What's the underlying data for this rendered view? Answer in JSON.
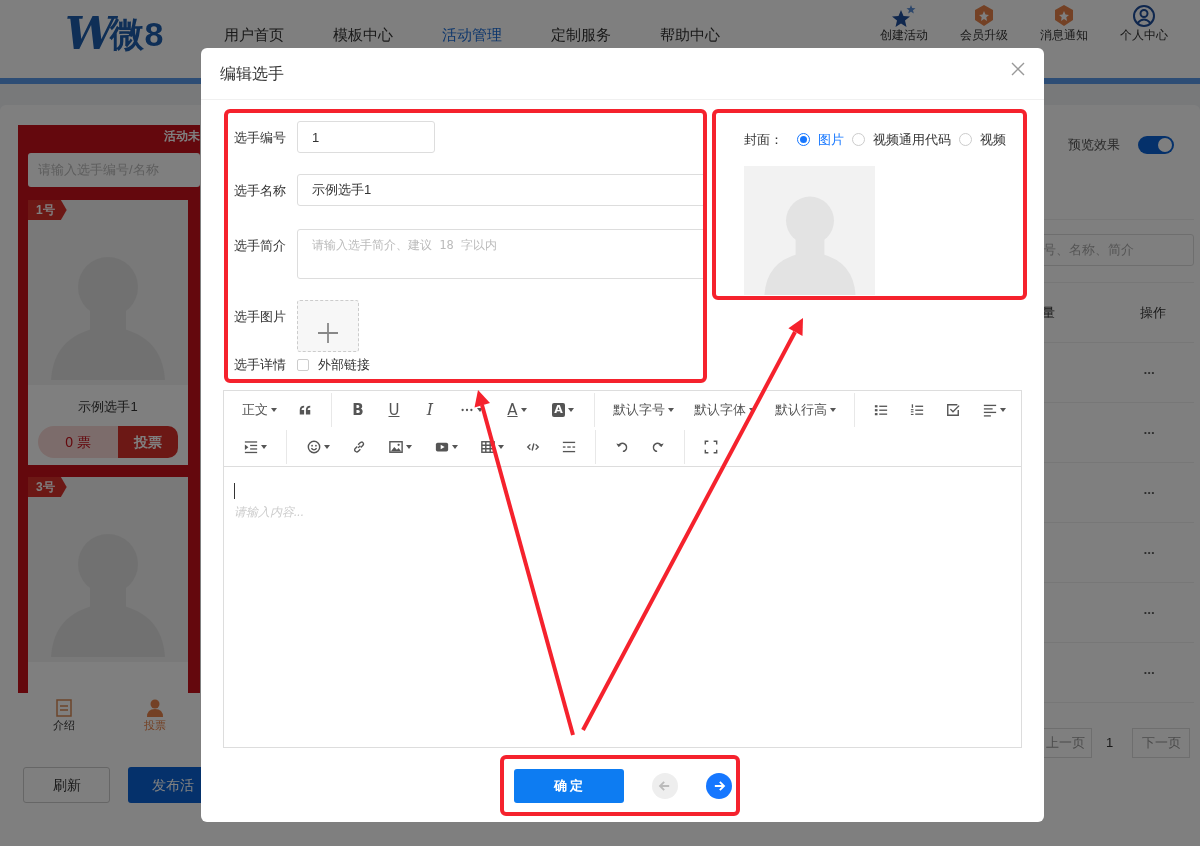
{
  "header": {
    "logo": {
      "mark": "W",
      "text": "微8"
    },
    "nav": [
      {
        "label": "用户首页",
        "selected": false
      },
      {
        "label": "模板中心",
        "selected": false
      },
      {
        "label": "活动管理",
        "selected": true
      },
      {
        "label": "定制服务",
        "selected": false
      },
      {
        "label": "帮助中心",
        "selected": false
      }
    ],
    "actions": [
      {
        "label": "创建活动"
      },
      {
        "label": "会员升级"
      },
      {
        "label": "消息通知"
      },
      {
        "label": "个人中心"
      }
    ]
  },
  "preview": {
    "status": "活动未",
    "search": {
      "placeholder": "请输入选手编号/名称"
    },
    "cards": [
      {
        "badge": "1号",
        "name": "示例选手1",
        "votes": "0 票",
        "vote_button": "投票"
      },
      {
        "badge": "3号"
      }
    ],
    "tabs": [
      {
        "label": "介绍",
        "selected": false
      },
      {
        "label": "投票",
        "selected": true
      }
    ]
  },
  "buttons": [
    {
      "label": "刷新",
      "kind": "default"
    },
    {
      "label": "发布活",
      "kind": "primary"
    }
  ],
  "right_panel": {
    "preview_toggle": {
      "label": "预览效果",
      "on": true
    },
    "search": {
      "placeholder": "号、名称、简介"
    },
    "columns": [
      "量",
      "操作"
    ],
    "rows": [
      {
        "action": "•••"
      },
      {
        "action": "•••"
      },
      {
        "action": "•••"
      },
      {
        "action": "•••"
      },
      {
        "action": "•••"
      },
      {
        "action": "•••"
      }
    ],
    "pagination": {
      "prev": "上一页",
      "page": "1",
      "next": "下一页"
    }
  },
  "dialog": {
    "title": "编辑选手",
    "form": [
      {
        "label": "选手编号",
        "kind": "input",
        "value": "1"
      },
      {
        "label": "选手名称",
        "kind": "input",
        "value": "示例选手1"
      },
      {
        "label": "选手简介",
        "kind": "textarea",
        "placeholder": "请输入选手简介、建议 18 字以内"
      },
      {
        "label": "选手图片",
        "kind": "upload"
      },
      {
        "label": "选手详情",
        "kind": "checkbox",
        "text": "外部链接",
        "checked": false
      }
    ],
    "cover": {
      "label": "封面：",
      "options": [
        {
          "label": "图片",
          "selected": true
        },
        {
          "label": "视频通用代码",
          "selected": false
        },
        {
          "label": "视频",
          "selected": false
        }
      ]
    },
    "editor": {
      "toolbar": [
        [
          [
            {
              "kind": "label",
              "text": "正文",
              "dropdown": true
            },
            {
              "kind": "icon",
              "dropdown": false
            }
          ],
          [
            {
              "kind": "bold",
              "text": "B",
              "dropdown": false
            },
            {
              "kind": "underline",
              "text": "U",
              "dropdown": false
            },
            {
              "kind": "italic",
              "text": "I",
              "dropdown": false
            },
            {
              "kind": "icon",
              "dropdown": true
            },
            {
              "kind": "font-color",
              "text": "A",
              "dropdown": true
            },
            {
              "kind": "bg-color",
              "text": "A",
              "dropdown": true
            }
          ],
          [
            {
              "kind": "label",
              "text": "默认字号",
              "dropdown": true
            },
            {
              "kind": "label",
              "text": "默认字体",
              "dropdown": true
            },
            {
              "kind": "label",
              "text": "默认行高",
              "dropdown": true
            }
          ],
          [
            {
              "kind": "icon",
              "dropdown": false
            },
            {
              "kind": "icon",
              "dropdown": false
            },
            {
              "kind": "icon",
              "dropdown": false
            },
            {
              "kind": "icon",
              "dropdown": true
            }
          ]
        ],
        [
          [
            {
              "kind": "icon",
              "dropdown": true
            }
          ],
          [
            {
              "kind": "icon",
              "dropdown": true
            },
            {
              "kind": "icon",
              "dropdown": false
            },
            {
              "kind": "icon",
              "dropdown": true
            },
            {
              "kind": "icon",
              "dropdown": true
            },
            {
              "kind": "icon",
              "dropdown": true
            },
            {
              "kind": "icon",
              "dropdown": false
            },
            {
              "kind": "icon",
              "dropdown": false
            }
          ],
          [
            {
              "kind": "icon",
              "dropdown": false
            },
            {
              "kind": "icon",
              "dropdown": false
            }
          ],
          [
            {
              "kind": "icon",
              "dropdown": false
            }
          ]
        ]
      ],
      "placeholder": "请输入内容..."
    },
    "confirm": "确 定",
    "nav_buttons": [
      {
        "kind": "prev",
        "disabled": true
      },
      {
        "kind": "next",
        "disabled": false
      }
    ]
  }
}
